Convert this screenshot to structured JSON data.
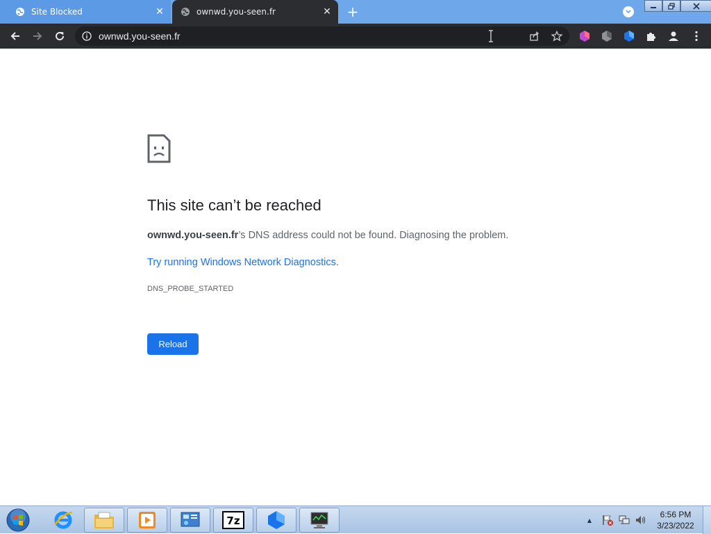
{
  "tabs": [
    {
      "title": "Site Blocked",
      "close": "✕"
    },
    {
      "title": "ownwd.you-seen.fr",
      "close": "✕"
    }
  ],
  "newtab_label": "+",
  "omnibox": {
    "url": "ownwd.you-seen.fr"
  },
  "error": {
    "title": "This site can’t be reached",
    "domain": "ownwd.you-seen.fr",
    "message": "’s DNS address could not be found. Diagnosing the problem.",
    "link": "Try running Windows Network Diagnostics",
    "link_suffix": ".",
    "code": "DNS_PROBE_STARTED",
    "reload_label": "Reload"
  },
  "taskbar": {
    "time": "6:56 PM",
    "date": "3/23/2022",
    "tray_arrow": "▲"
  },
  "colors": {
    "accent": "#1a73e8",
    "toolbar": "#2b2d31",
    "tabstrip": "#6fa8ea"
  }
}
